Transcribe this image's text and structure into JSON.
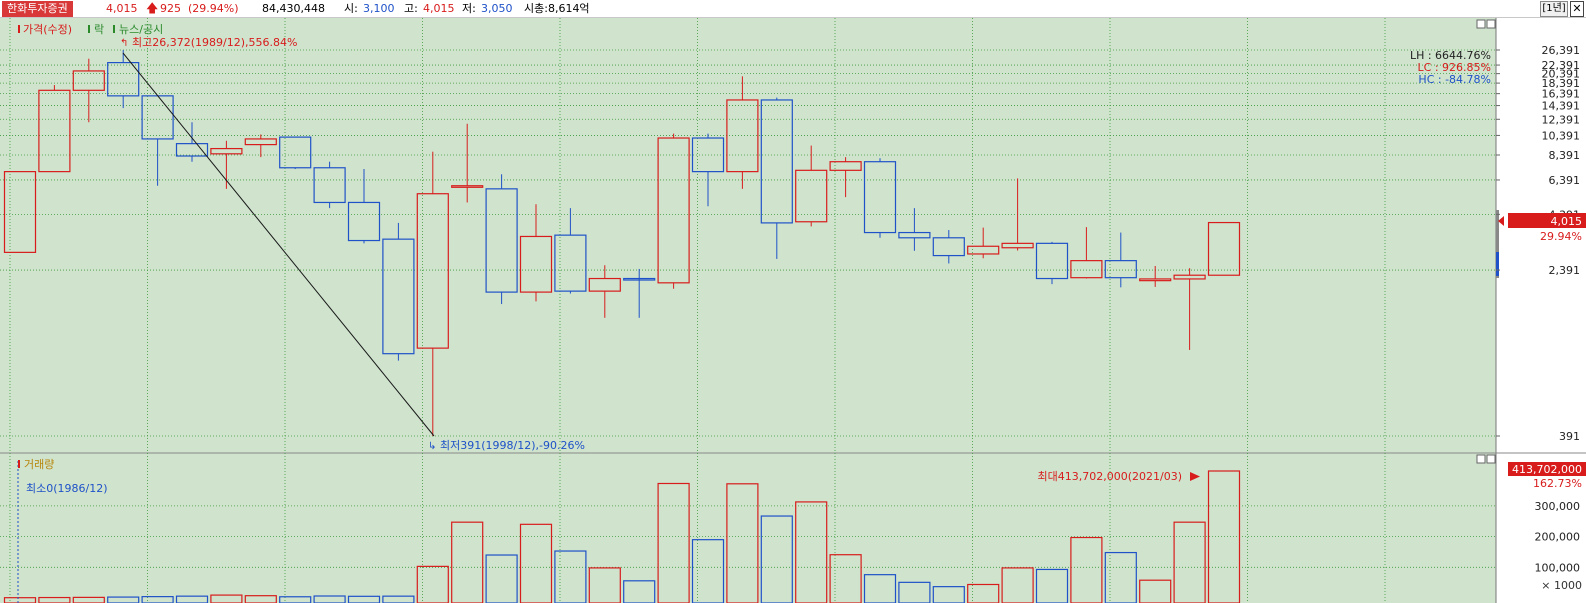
{
  "header": {
    "stock_name": "한화투자증권",
    "price": "4,015",
    "change": "925",
    "change_pct": "(29.94%)",
    "volume": "84,430,448",
    "open_label": "시:",
    "open": "3,100",
    "high_label": "고:",
    "high": "4,015",
    "low_label": "저:",
    "low": "3,050",
    "mcap": "시총:8,614억",
    "period": "[1년]",
    "close_glyph": "✕"
  },
  "colors": {
    "up": "#d81c1c",
    "down": "#1f52c8",
    "bg": "#cfe3cd",
    "grid": "#3c9a3c"
  },
  "price_panel": {
    "legend_price": "가격(수정)",
    "legend_rights": "락",
    "legend_news": "뉴스/공시",
    "high_annotation": "최고26,372(1989/12),556.84%",
    "low_annotation": "최저391(1998/12),-90.26%",
    "stats": {
      "lh": "LH : 6644.76%",
      "lc": "LC : 926.85%",
      "hc": "HC : -84.78%"
    },
    "current_price": "4,015",
    "current_pct": "29.94%"
  },
  "volume_panel": {
    "legend": "거래량",
    "min_annotation": "최소0(1986/12)",
    "max_annotation": "최대413,702,000(2021/03)",
    "max_label": "413,702,000",
    "max_pct": "162.73%",
    "unit": "× 1000"
  },
  "chart_data": [
    {
      "type": "candlestick",
      "title": "가격(수정)",
      "scale": "log",
      "y_ticks": [
        26391,
        22391,
        20391,
        18391,
        16391,
        14391,
        12391,
        10391,
        8391,
        6391,
        4391,
        2391,
        391
      ],
      "y_tick_labels": [
        "26,391",
        "22,391",
        "20,391",
        "18,391",
        "16,391",
        "14,391",
        "12,391",
        "10,391",
        "8,391",
        "6,391",
        "4,391",
        "2,391",
        "391"
      ],
      "ylim": [
        391,
        26391
      ],
      "series": [
        {
          "open": 7000,
          "high": 7000,
          "low": 2900,
          "close": 2900,
          "color": "up"
        },
        {
          "open": 7000,
          "high": 18000,
          "low": 7000,
          "close": 17000,
          "color": "up"
        },
        {
          "open": 17000,
          "high": 24000,
          "low": 12000,
          "close": 21000,
          "color": "up"
        },
        {
          "open": 23000,
          "high": 26372,
          "low": 14000,
          "close": 16000,
          "color": "down"
        },
        {
          "open": 16000,
          "high": 16000,
          "low": 6000,
          "close": 10000,
          "color": "down"
        },
        {
          "open": 9500,
          "high": 12000,
          "low": 7800,
          "close": 8300,
          "color": "down"
        },
        {
          "open": 8500,
          "high": 9800,
          "low": 5800,
          "close": 9000,
          "color": "up"
        },
        {
          "open": 9400,
          "high": 10500,
          "low": 8200,
          "close": 10000,
          "color": "up"
        },
        {
          "open": 10200,
          "high": 10200,
          "low": 7200,
          "close": 7300,
          "color": "down"
        },
        {
          "open": 7300,
          "high": 7800,
          "low": 4700,
          "close": 5000,
          "color": "down"
        },
        {
          "open": 5000,
          "high": 7200,
          "low": 3200,
          "close": 3300,
          "color": "down"
        },
        {
          "open": 3350,
          "high": 4000,
          "low": 890,
          "close": 960,
          "color": "down"
        },
        {
          "open": 1020,
          "high": 8700,
          "low": 391,
          "close": 5500,
          "color": "up"
        },
        {
          "open": 5900,
          "high": 11800,
          "low": 5000,
          "close": 6000,
          "color": "up"
        },
        {
          "open": 5800,
          "high": 6800,
          "low": 1650,
          "close": 1880,
          "color": "down"
        },
        {
          "open": 1880,
          "high": 4900,
          "low": 1700,
          "close": 3450,
          "color": "up"
        },
        {
          "open": 3500,
          "high": 4700,
          "low": 1850,
          "close": 1900,
          "color": "down"
        },
        {
          "open": 1900,
          "high": 2520,
          "low": 1420,
          "close": 2180,
          "color": "up"
        },
        {
          "open": 2180,
          "high": 2420,
          "low": 1420,
          "close": 2180,
          "color": "down"
        },
        {
          "open": 2080,
          "high": 10600,
          "low": 1950,
          "close": 10100,
          "color": "up"
        },
        {
          "open": 10100,
          "high": 10600,
          "low": 4800,
          "close": 7000,
          "color": "down"
        },
        {
          "open": 7000,
          "high": 19800,
          "low": 5800,
          "close": 15300,
          "color": "up"
        },
        {
          "open": 15300,
          "high": 15700,
          "low": 2700,
          "close": 4000,
          "color": "down"
        },
        {
          "open": 4050,
          "high": 9300,
          "low": 3850,
          "close": 7100,
          "color": "up"
        },
        {
          "open": 7100,
          "high": 8200,
          "low": 5300,
          "close": 7800,
          "color": "up"
        },
        {
          "open": 7800,
          "high": 8100,
          "low": 3400,
          "close": 3600,
          "color": "down"
        },
        {
          "open": 3600,
          "high": 4700,
          "low": 2950,
          "close": 3400,
          "color": "down"
        },
        {
          "open": 3400,
          "high": 3700,
          "low": 2570,
          "close": 2800,
          "color": "down"
        },
        {
          "open": 2850,
          "high": 3800,
          "low": 2720,
          "close": 3100,
          "color": "up"
        },
        {
          "open": 3050,
          "high": 6500,
          "low": 2960,
          "close": 3200,
          "color": "up"
        },
        {
          "open": 3200,
          "high": 3250,
          "low": 2050,
          "close": 2180,
          "color": "down"
        },
        {
          "open": 2200,
          "high": 3820,
          "low": 2180,
          "close": 2650,
          "color": "up"
        },
        {
          "open": 2650,
          "high": 3600,
          "low": 1980,
          "close": 2200,
          "color": "down"
        },
        {
          "open": 2170,
          "high": 2500,
          "low": 1990,
          "close": 2130,
          "color": "up"
        },
        {
          "open": 2170,
          "high": 2440,
          "low": 1000,
          "close": 2260,
          "color": "up"
        },
        {
          "open": 2260,
          "high": 4015,
          "low": 2260,
          "close": 4015,
          "color": "up"
        }
      ]
    },
    {
      "type": "bar",
      "title": "거래량",
      "unit": "× 1000",
      "y_ticks": [
        100000,
        200000,
        300000
      ],
      "y_tick_labels": [
        "100,000",
        "200,000",
        "300,000"
      ],
      "ylim": [
        0,
        413702
      ],
      "series": [
        {
          "name": "거래량",
          "values": [
            1000,
            1500,
            2000,
            3000,
            4500,
            6000,
            9500,
            7500,
            4000,
            6500,
            5500,
            6000,
            103000,
            247000,
            140000,
            240000,
            153000,
            98000,
            56000,
            373000,
            190000,
            372000,
            267000,
            313000,
            141000,
            76000,
            51000,
            37000,
            44000,
            98000,
            93000,
            197000,
            148000,
            58000,
            247000,
            413702
          ],
          "colors": [
            "up",
            "up",
            "up",
            "down",
            "down",
            "down",
            "up",
            "up",
            "down",
            "down",
            "down",
            "down",
            "up",
            "up",
            "down",
            "up",
            "down",
            "up",
            "down",
            "up",
            "down",
            "up",
            "down",
            "up",
            "up",
            "down",
            "down",
            "down",
            "up",
            "up",
            "down",
            "up",
            "down",
            "up",
            "up",
            "up"
          ]
        }
      ]
    }
  ]
}
